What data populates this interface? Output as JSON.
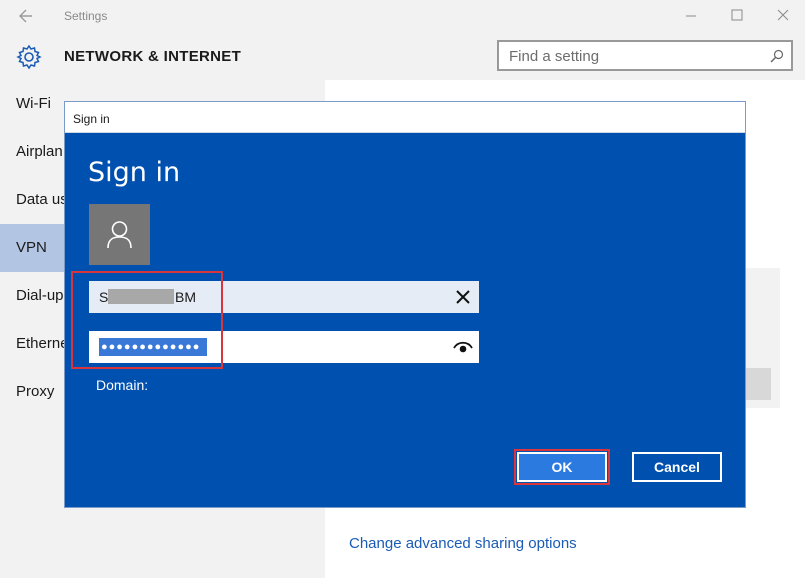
{
  "window": {
    "title": "Settings",
    "section_title": "NETWORK & INTERNET",
    "search_placeholder": "Find a setting"
  },
  "nav": {
    "items": [
      {
        "label": "Wi-Fi"
      },
      {
        "label": "Airplan"
      },
      {
        "label": "Data us"
      },
      {
        "label": "VPN"
      },
      {
        "label": "Dial-up"
      },
      {
        "label": "Ethernet"
      },
      {
        "label": "Proxy"
      }
    ]
  },
  "content": {
    "link_change_sharing": "Change advanced sharing options"
  },
  "dialog": {
    "titlebar": "Sign in",
    "heading": "Sign in",
    "username_prefix": "S",
    "username_suffix": "BM",
    "password_mask": "●●●●●●●●●●●●●",
    "domain_label": "Domain:",
    "ok_label": "OK",
    "cancel_label": "Cancel"
  },
  "colors": {
    "dialog_bg": "#0050b0",
    "highlight": "#d9353c",
    "active_nav": "#b2c6e4"
  }
}
